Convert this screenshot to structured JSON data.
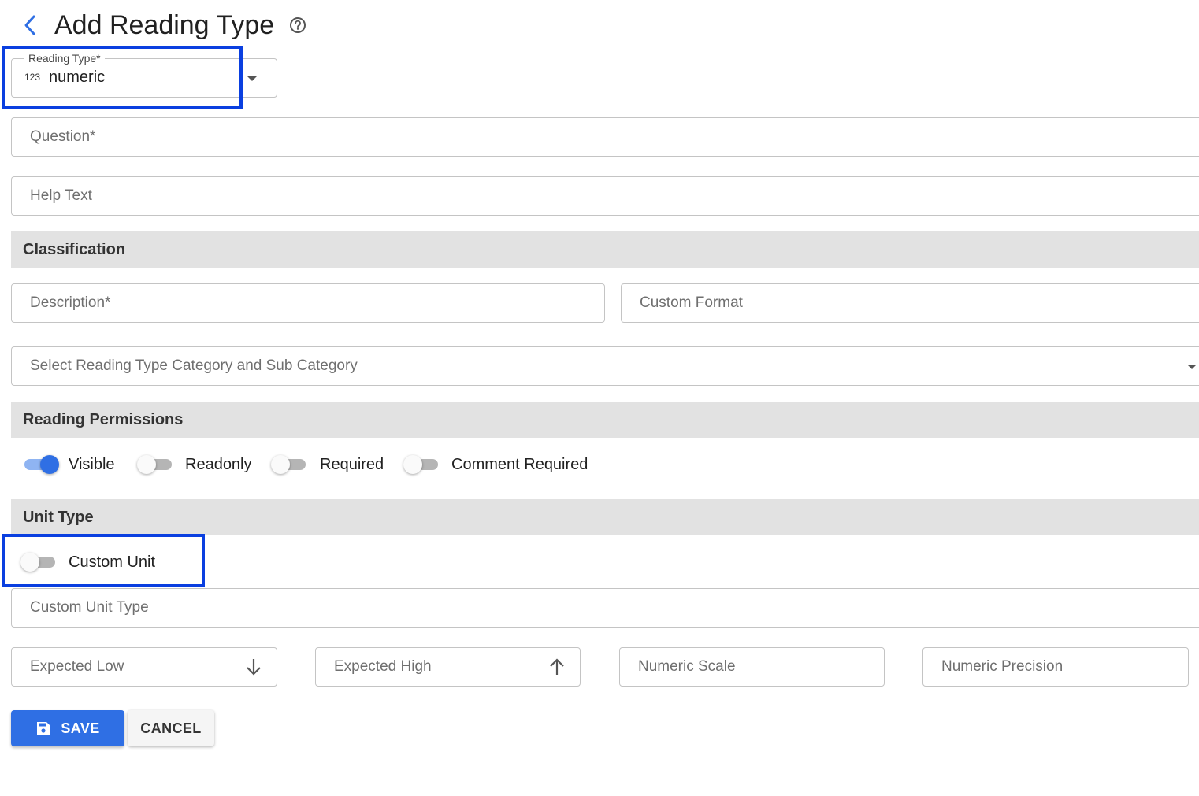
{
  "header": {
    "title": "Add Reading Type"
  },
  "reading_type": {
    "label": "Reading Type*",
    "prefix": "123",
    "value": "numeric"
  },
  "fields": {
    "question": "Question*",
    "help_text": "Help Text",
    "description": "Description*",
    "custom_format": "Custom Format",
    "category": "Select Reading Type Category and Sub Category",
    "custom_unit_type": "Custom Unit Type",
    "expected_low": "Expected Low",
    "expected_high": "Expected High",
    "numeric_scale": "Numeric Scale",
    "numeric_precision": "Numeric Precision"
  },
  "sections": {
    "classification": "Classification",
    "permissions": "Reading Permissions",
    "unit_type": "Unit Type"
  },
  "permissions": [
    {
      "label": "Visible",
      "checked": true
    },
    {
      "label": "Readonly",
      "checked": false
    },
    {
      "label": "Required",
      "checked": false
    },
    {
      "label": "Comment Required",
      "checked": false
    }
  ],
  "custom_unit": {
    "label": "Custom Unit",
    "checked": false
  },
  "actions": {
    "save": "SAVE",
    "cancel": "CANCEL"
  },
  "colors": {
    "primary": "#2f6fe4",
    "highlight": "#0a3fe0",
    "section_bg": "#e2e2e2"
  }
}
